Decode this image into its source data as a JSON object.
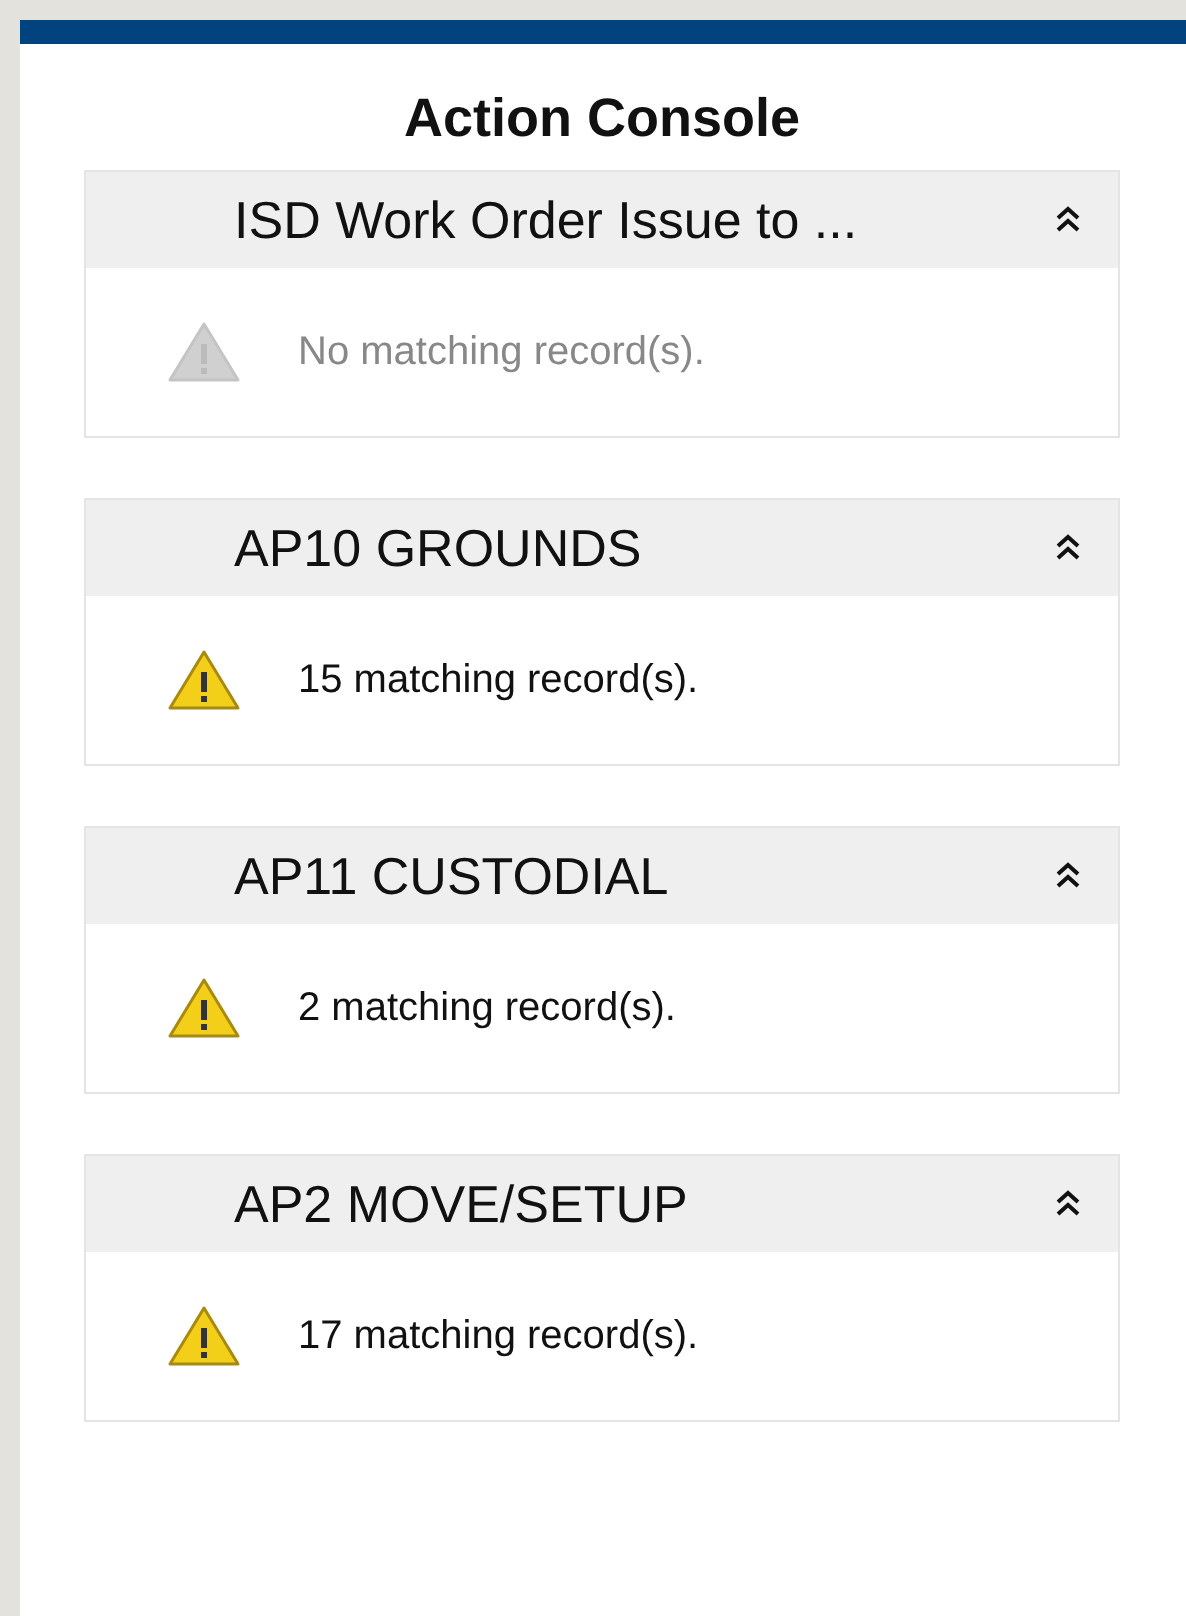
{
  "title": "Action Console",
  "panels": [
    {
      "title": "ISD Work Order Issue to ...",
      "message": "No matching record(s).",
      "disabled": true,
      "expanded": true
    },
    {
      "title": "AP10 GROUNDS",
      "message": "15 matching record(s).",
      "disabled": false,
      "expanded": true
    },
    {
      "title": "AP11 CUSTODIAL",
      "message": "2 matching record(s).",
      "disabled": false,
      "expanded": true
    },
    {
      "title": "AP2 MOVE/SETUP",
      "message": "17 matching record(s).",
      "disabled": false,
      "expanded": true
    }
  ]
}
